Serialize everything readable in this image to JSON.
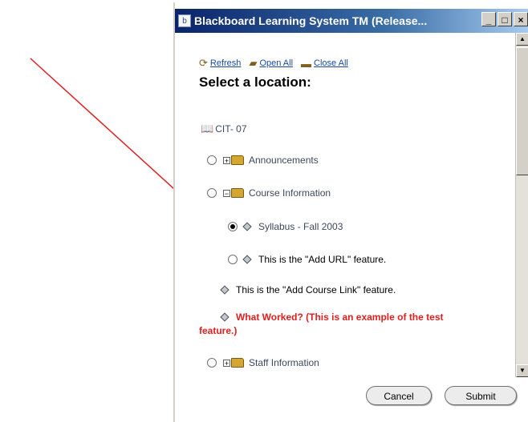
{
  "window": {
    "title": "Blackboard Learning System TM (Release...",
    "buttons": {
      "minimize": "_",
      "maximize": "□",
      "close": "×"
    }
  },
  "toolbar": {
    "refresh_label": "Refresh",
    "open_all_label": "Open All",
    "close_all_label": "Close All"
  },
  "heading": "Select a location:",
  "tree": {
    "root": "CIT- 07",
    "announcements": "Announcements",
    "course_information": "Course Information",
    "syllabus": "Syllabus - Fall 2003",
    "add_url": "This is the \"Add URL\" feature.",
    "add_course_link": "This is the \"Add Course Link\" feature.",
    "test_feature_line1": "What Worked? (This is an example of the test",
    "test_feature_line2": "feature.)",
    "staff_information": "Staff Information"
  },
  "footer": {
    "cancel_label": "Cancel",
    "submit_label": "Submit"
  },
  "colors": {
    "titlebar_start": "#0a246a",
    "link": "#1a4aa0",
    "test_feature_text": "#e02020",
    "arrow": "#e02020"
  }
}
